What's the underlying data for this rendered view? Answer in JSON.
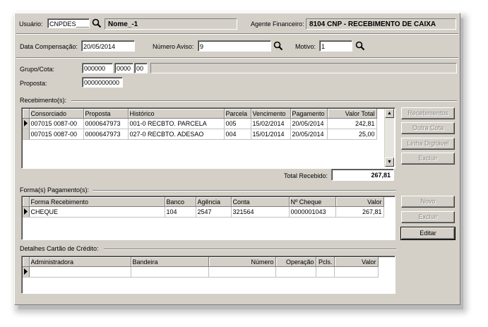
{
  "header": {
    "usuario_label": "Usuário:",
    "usuario_value": "CNPDES____",
    "nome_value": "Nome_-1",
    "agente_label": "Agente Financeiro:",
    "agente_value": "8104  CNP - RECEBIMENTO DE CAIXA"
  },
  "filters": {
    "data_label": "Data Compensação:",
    "data_value": "20/05/2014",
    "aviso_label": "Número Aviso:",
    "aviso_value": "9",
    "motivo_label": "Motivo:",
    "motivo_value": "1"
  },
  "grupo": {
    "label": "Grupo/Cota:",
    "grupo_value": "000000",
    "cota_value": "0000",
    "digito_value": "00",
    "proposta_label": "Proposta:",
    "proposta_value": "0000000000"
  },
  "recebimentos": {
    "section_label": "Recebimento(s):",
    "columns": [
      "Consorciado",
      "Proposta",
      "Histórico",
      "Parcela",
      "Vencimento",
      "Pagamento",
      "Valor Total"
    ],
    "rows": [
      [
        "007015 0087-00",
        "0000647973",
        "001-0 RECBTO. PARCELA",
        "005",
        "15/02/2014",
        "20/05/2014",
        "242,81"
      ],
      [
        "007015 0087-00",
        "0000647973",
        "027-0 RECBTO. ADESAO",
        "004",
        "15/01/2014",
        "20/05/2014",
        "25,00"
      ]
    ],
    "total_label": "Total Recebido:",
    "total_value": "267,81",
    "buttons": {
      "recebimentos": "Recebimentos",
      "outra_cota": "Outra Cota",
      "linha_digitavel": "Linha Digitável",
      "excluir": "Excluir"
    }
  },
  "pagamentos": {
    "section_label": "Forma(s) Pagamento(s):",
    "columns": [
      "Forma Recebimento",
      "Banco",
      "Agência",
      "Conta",
      "Nº Cheque",
      "Valor"
    ],
    "rows": [
      [
        "CHEQUE",
        "104",
        "2547",
        "321564",
        "0000001043",
        "267,81"
      ]
    ],
    "buttons": {
      "novo": "Novo",
      "excluir": "Excluir",
      "editar": "Editar"
    }
  },
  "cartao": {
    "section_label": "Detalhes Cartão de Crédito:",
    "columns": [
      "Administradora",
      "Bandeira",
      "Número",
      "Operação",
      "Pcls.",
      "Valor"
    ]
  },
  "icons": {
    "search": "search-icon",
    "row_indicator": "row-indicator-icon",
    "scroll_up": "scroll-up-icon",
    "scroll_down": "scroll-down-icon"
  }
}
